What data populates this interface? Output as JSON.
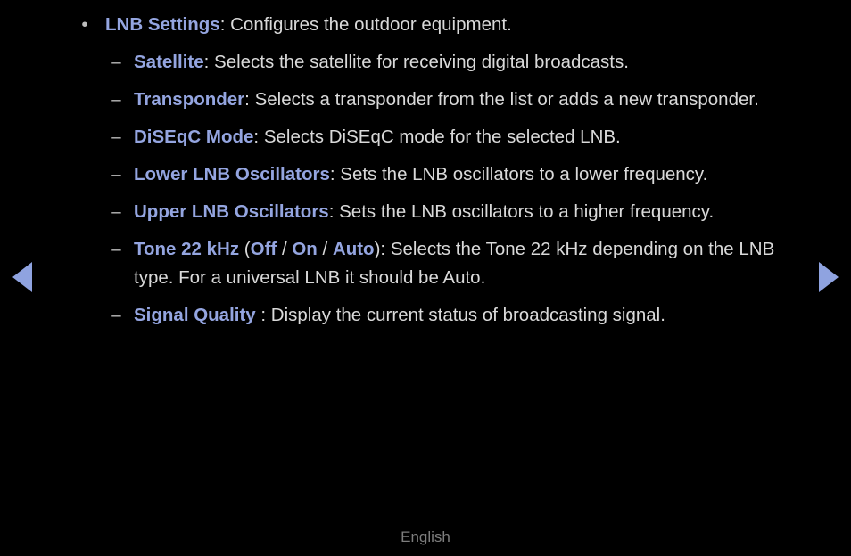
{
  "background_color": "#000000",
  "accent_color": "#94a5e0",
  "body_text_color": "#d9d9d9",
  "arrow_color": "#8fa3e0",
  "nav": {
    "prev_label": "◀",
    "next_label": "▶",
    "prev_name": "previous-page-arrow",
    "next_name": "next-page-arrow"
  },
  "topic": {
    "marker": "•",
    "term": "LNB Settings",
    "separator": ": ",
    "description": "Configures the outdoor equipment."
  },
  "sub_items": [
    {
      "marker": "–",
      "term": "Satellite",
      "separator": ": ",
      "description": "Selects the satellite for receiving digital broadcasts."
    },
    {
      "marker": "–",
      "term": "Transponder",
      "separator": ": ",
      "description": "Selects a transponder from the list or adds a new transponder."
    },
    {
      "marker": "–",
      "term": "DiSEqC Mode",
      "separator": ": ",
      "description": "Selects DiSEqC mode for the selected LNB."
    },
    {
      "marker": "–",
      "term": "Lower LNB Oscillators",
      "separator": ": ",
      "description": "Sets the LNB oscillators to a lower frequency."
    },
    {
      "marker": "–",
      "term": "Upper LNB Oscillators",
      "separator": ": ",
      "description": "Sets the LNB oscillators to a higher frequency."
    },
    {
      "marker": "–",
      "term": "Tone 22 kHz",
      "options_open": " (",
      "options": [
        "Off",
        "On",
        "Auto"
      ],
      "options_sep": " / ",
      "options_close": ")",
      "separator": ": ",
      "description": "Selects the Tone 22 kHz depending on the LNB type. For a universal LNB it should be Auto."
    },
    {
      "marker": "–",
      "term": "Signal Quality",
      "separator": " : ",
      "description": "Display the current status of broadcasting signal."
    }
  ],
  "footer": {
    "language": "English"
  }
}
